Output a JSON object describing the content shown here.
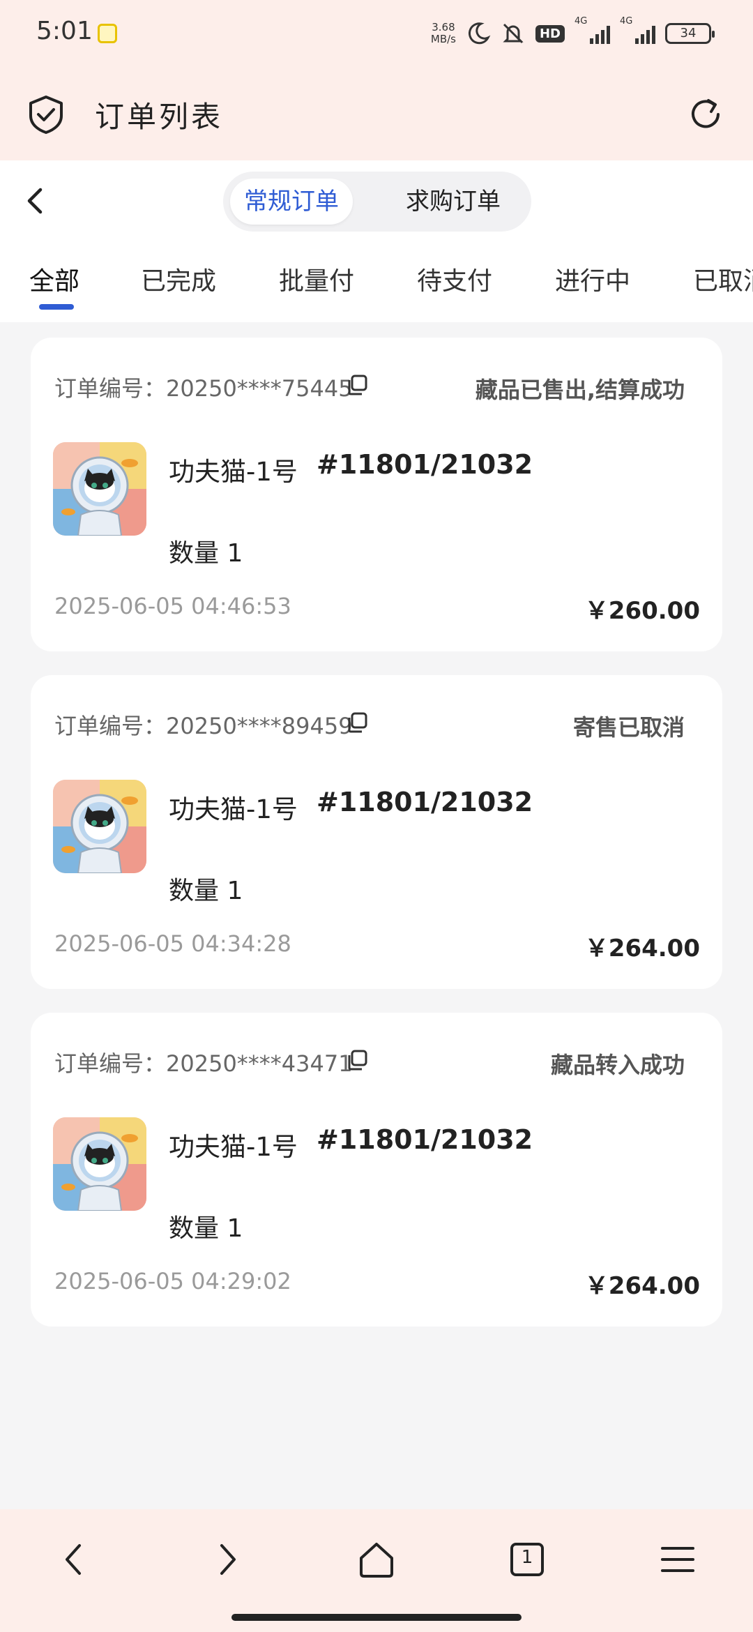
{
  "status_bar": {
    "time": "5:01",
    "net_speed_value": "3.68",
    "net_speed_unit": "MB/s",
    "hd_label": "HD",
    "signal1": "4G",
    "signal2": "4G",
    "battery": "34"
  },
  "header": {
    "title": "订单列表"
  },
  "segment": {
    "active": "常规订单",
    "inactive": "求购订单"
  },
  "tabs": [
    "全部",
    "已完成",
    "批量付",
    "待支付",
    "进行中",
    "已取消"
  ],
  "orders": [
    {
      "order_no": "订单编号：20250****75445",
      "status": "藏品已售出,结算成功",
      "name": "功夫猫-1号",
      "serial": "#11801/21032",
      "qty": "数量 1",
      "time": "2025-06-05 04:46:53",
      "price": "￥260.00"
    },
    {
      "order_no": "订单编号：20250****89459",
      "status": "寄售已取消",
      "name": "功夫猫-1号",
      "serial": "#11801/21032",
      "qty": "数量 1",
      "time": "2025-06-05 04:34:28",
      "price": "￥264.00"
    },
    {
      "order_no": "订单编号：20250****43471",
      "status": "藏品转入成功",
      "name": "功夫猫-1号",
      "serial": "#11801/21032",
      "qty": "数量 1",
      "time": "2025-06-05 04:29:02",
      "price": "￥264.00"
    }
  ],
  "bottom_bar": {
    "tab_count": "1"
  },
  "colors": {
    "accent": "#2f5cd4",
    "header_bg": "#fdeeea",
    "page_bg": "#f5f5f6"
  }
}
